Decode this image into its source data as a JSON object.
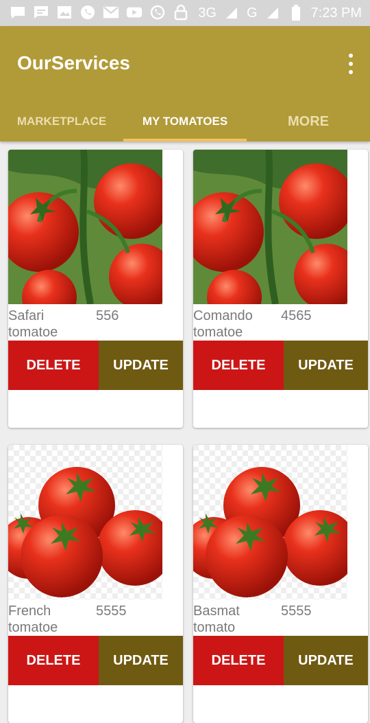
{
  "status_bar": {
    "icons": [
      "message-icon",
      "chat-icon",
      "image-icon",
      "whatsapp-icon",
      "gmail-icon",
      "youtube-icon",
      "whatsapp-icon",
      "lock-icon"
    ],
    "network_1": "3G",
    "network_2": "G",
    "time": "7:23 PM"
  },
  "app": {
    "title": "OurServices"
  },
  "tabs": [
    {
      "label": "MARKETPLACE"
    },
    {
      "label": "MY TOMATOES"
    },
    {
      "label": "MORE"
    }
  ],
  "cards": [
    {
      "name": "Safari tomatoe",
      "price": "556",
      "delete_label": "DELETE",
      "update_label": "UPDATE"
    },
    {
      "name": "Comando tomatoe",
      "price": "4565",
      "delete_label": "DELETE",
      "update_label": "UPDATE"
    },
    {
      "name": "French tomatoe",
      "price": "5555",
      "delete_label": "DELETE",
      "update_label": "UPDATE"
    },
    {
      "name": "Basmat tomato",
      "price": "5555",
      "delete_label": "DELETE",
      "update_label": "UPDATE"
    }
  ],
  "colors": {
    "app_bar": "#b19a38",
    "tab_indicator": "#f2c25c",
    "delete_button": "#cc1616",
    "update_button": "#6f5a12"
  }
}
